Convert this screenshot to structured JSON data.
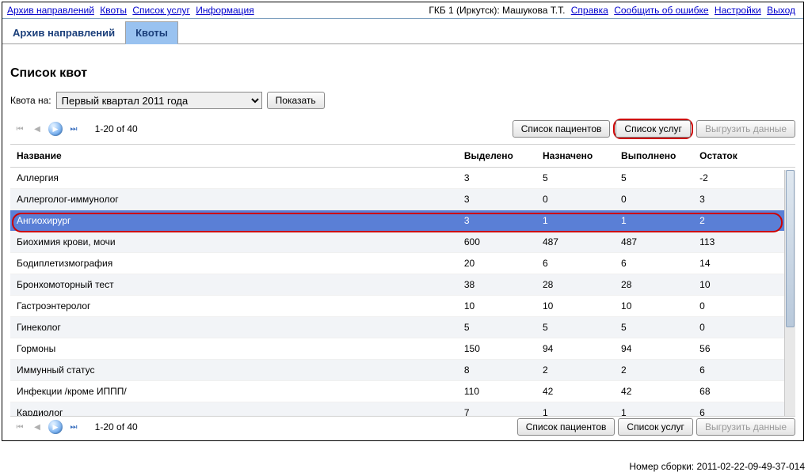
{
  "topnav": {
    "left": [
      "Архив направлений",
      "Квоты",
      "Список услуг",
      "Информация"
    ],
    "user_context": "ГКБ 1 (Иркутск): Машукова Т.Т.",
    "right": [
      "Справка",
      "Сообщить об ошибке",
      "Настройки",
      "Выход"
    ]
  },
  "tabs": [
    "Архив направлений",
    "Квоты"
  ],
  "active_tab": 1,
  "page_title": "Список квот",
  "filter": {
    "label": "Квота на:",
    "selected": "Первый квартал 2011 года",
    "show_button": "Показать"
  },
  "pagination": {
    "text": "1-20 of 40"
  },
  "action_buttons": {
    "patients": "Список пациентов",
    "services": "Список услуг",
    "export": "Выгрузить данные"
  },
  "columns": [
    "Название",
    "Выделено",
    "Назначено",
    "Выполнено",
    "Остаток"
  ],
  "rows": [
    {
      "name": "Аллергия",
      "allocated": "3",
      "assigned": "5",
      "done": "5",
      "rest": "-2"
    },
    {
      "name": "Аллерголог-иммунолог",
      "allocated": "3",
      "assigned": "0",
      "done": "0",
      "rest": "3"
    },
    {
      "name": "Ангиохирург",
      "allocated": "3",
      "assigned": "1",
      "done": "1",
      "rest": "2",
      "selected": true
    },
    {
      "name": "Биохимия крови, мочи",
      "allocated": "600",
      "assigned": "487",
      "done": "487",
      "rest": "113"
    },
    {
      "name": "Бодиплетизмография",
      "allocated": "20",
      "assigned": "6",
      "done": "6",
      "rest": "14"
    },
    {
      "name": "Бронхомоторный тест",
      "allocated": "38",
      "assigned": "28",
      "done": "28",
      "rest": "10"
    },
    {
      "name": "Гастроэнтеролог",
      "allocated": "10",
      "assigned": "10",
      "done": "10",
      "rest": "0"
    },
    {
      "name": "Гинеколог",
      "allocated": "5",
      "assigned": "5",
      "done": "5",
      "rest": "0"
    },
    {
      "name": "Гормоны",
      "allocated": "150",
      "assigned": "94",
      "done": "94",
      "rest": "56"
    },
    {
      "name": "Иммунный статус",
      "allocated": "8",
      "assigned": "2",
      "done": "2",
      "rest": "6"
    },
    {
      "name": "Инфекции /кроме ИППП/",
      "allocated": "110",
      "assigned": "42",
      "done": "42",
      "rest": "68"
    },
    {
      "name": "Кардиолог",
      "allocated": "7",
      "assigned": "1",
      "done": "1",
      "rest": "6"
    }
  ],
  "build": {
    "label": "Номер сборки:",
    "value": "2011-02-22-09-49-37-014"
  }
}
